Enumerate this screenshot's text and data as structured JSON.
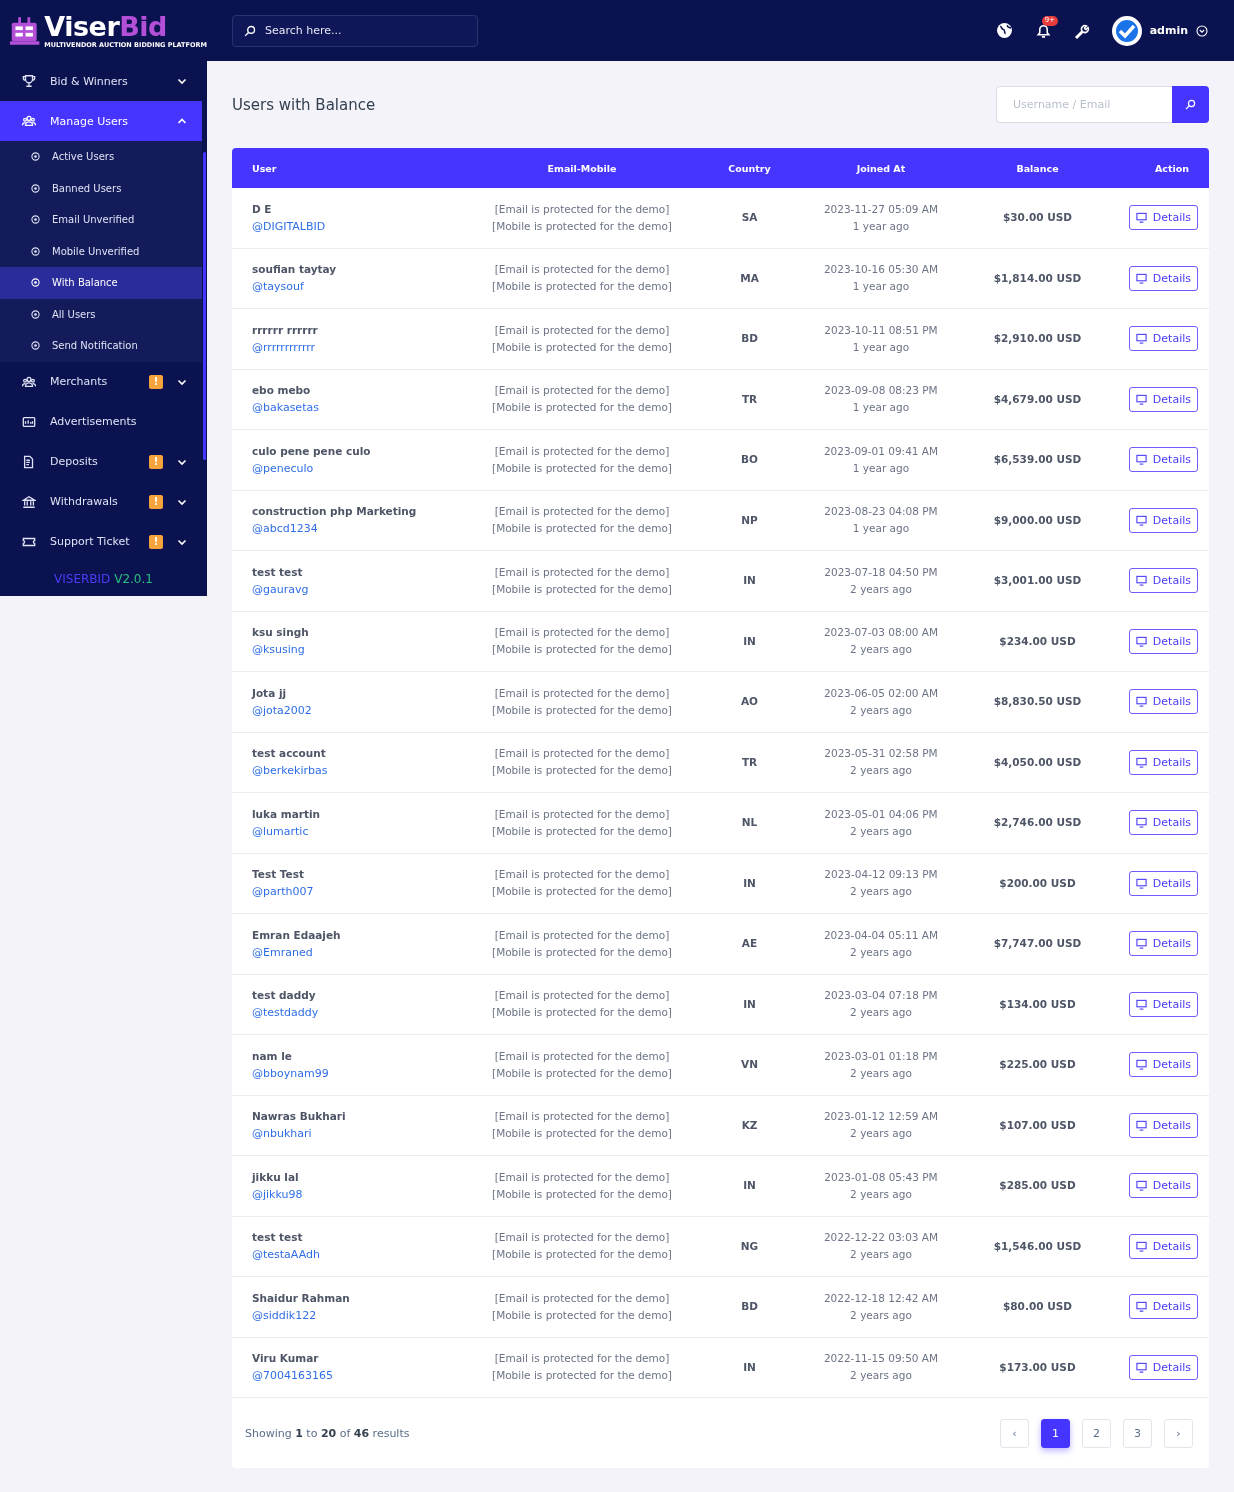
{
  "sidebar": {
    "logo": {
      "word_1": "Viser",
      "word_2": "Bid",
      "tagline": "MULTIVENDOR AUCTION BIDDING PLATFORM"
    },
    "items": [
      {
        "label": "Bid & Winners",
        "selected": false,
        "expanded": false
      },
      {
        "label": "Manage Users",
        "selected": true,
        "expanded": true,
        "children": [
          {
            "label": "Active Users",
            "selected": false
          },
          {
            "label": "Banned Users",
            "selected": false
          },
          {
            "label": "Email Unverified",
            "selected": false
          },
          {
            "label": "Mobile Unverified",
            "selected": false
          },
          {
            "label": "With Balance",
            "selected": true
          },
          {
            "label": "All Users",
            "selected": false
          },
          {
            "label": "Send Notification",
            "selected": false
          }
        ]
      },
      {
        "label": "Merchants",
        "selected": false,
        "expanded": false,
        "badge": "!"
      },
      {
        "label": "Advertisements",
        "selected": false
      },
      {
        "label": "Deposits",
        "selected": false,
        "expanded": false,
        "badge": "!"
      },
      {
        "label": "Withdrawals",
        "selected": false,
        "expanded": false,
        "badge": "!"
      },
      {
        "label": "Support Ticket",
        "selected": false,
        "expanded": false,
        "badge": "!"
      }
    ],
    "version": {
      "name": "VISERBID",
      "number": "V2.0.1"
    }
  },
  "topbar": {
    "search": {
      "placeholder": "Search here..."
    },
    "notification_count": "9+",
    "user": "admin"
  },
  "page": {
    "title": "Users with Balance",
    "search": {
      "placeholder": "Username / Email"
    }
  },
  "table": {
    "columns": [
      "User",
      "Email-Mobile",
      "Country",
      "Joined At",
      "Balance",
      "Action"
    ],
    "rows": [
      {
        "name": "D E",
        "username": "@DIGITALBID",
        "email": "[Email is protected for the demo]",
        "mobile": "[Mobile is protected for the demo]",
        "country": "SA",
        "joined": "2023-11-27 05:09 AM",
        "ago": "1 year ago",
        "balance": "$30.00 USD",
        "action": "Details"
      },
      {
        "name": "soufian taytay",
        "username": "@taysouf",
        "email": "[Email is protected for the demo]",
        "mobile": "[Mobile is protected for the demo]",
        "country": "MA",
        "joined": "2023-10-16 05:30 AM",
        "ago": "1 year ago",
        "balance": "$1,814.00 USD",
        "action": "Details"
      },
      {
        "name": "rrrrrr rrrrrr",
        "username": "@rrrrrrrrrrrr",
        "email": "[Email is protected for the demo]",
        "mobile": "[Mobile is protected for the demo]",
        "country": "BD",
        "joined": "2023-10-11 08:51 PM",
        "ago": "1 year ago",
        "balance": "$2,910.00 USD",
        "action": "Details"
      },
      {
        "name": "ebo mebo",
        "username": "@bakasetas",
        "email": "[Email is protected for the demo]",
        "mobile": "[Mobile is protected for the demo]",
        "country": "TR",
        "joined": "2023-09-08 08:23 PM",
        "ago": "1 year ago",
        "balance": "$4,679.00 USD",
        "action": "Details"
      },
      {
        "name": "culo pene pene culo",
        "username": "@peneculo",
        "email": "[Email is protected for the demo]",
        "mobile": "[Mobile is protected for the demo]",
        "country": "BO",
        "joined": "2023-09-01 09:41 AM",
        "ago": "1 year ago",
        "balance": "$6,539.00 USD",
        "action": "Details"
      },
      {
        "name": "construction php Marketing",
        "username": "@abcd1234",
        "email": "[Email is protected for the demo]",
        "mobile": "[Mobile is protected for the demo]",
        "country": "NP",
        "joined": "2023-08-23 04:08 PM",
        "ago": "1 year ago",
        "balance": "$9,000.00 USD",
        "action": "Details"
      },
      {
        "name": "test test",
        "username": "@gauravg",
        "email": "[Email is protected for the demo]",
        "mobile": "[Mobile is protected for the demo]",
        "country": "IN",
        "joined": "2023-07-18 04:50 PM",
        "ago": "2 years ago",
        "balance": "$3,001.00 USD",
        "action": "Details"
      },
      {
        "name": "ksu singh",
        "username": "@ksusing",
        "email": "[Email is protected for the demo]",
        "mobile": "[Mobile is protected for the demo]",
        "country": "IN",
        "joined": "2023-07-03 08:00 AM",
        "ago": "2 years ago",
        "balance": "$234.00 USD",
        "action": "Details"
      },
      {
        "name": "Jota jj",
        "username": "@jota2002",
        "email": "[Email is protected for the demo]",
        "mobile": "[Mobile is protected for the demo]",
        "country": "AO",
        "joined": "2023-06-05 02:00 AM",
        "ago": "2 years ago",
        "balance": "$8,830.50 USD",
        "action": "Details"
      },
      {
        "name": "test account",
        "username": "@berkekirbas",
        "email": "[Email is protected for the demo]",
        "mobile": "[Mobile is protected for the demo]",
        "country": "TR",
        "joined": "2023-05-31 02:58 PM",
        "ago": "2 years ago",
        "balance": "$4,050.00 USD",
        "action": "Details"
      },
      {
        "name": "luka martin",
        "username": "@lumartic",
        "email": "[Email is protected for the demo]",
        "mobile": "[Mobile is protected for the demo]",
        "country": "NL",
        "joined": "2023-05-01 04:06 PM",
        "ago": "2 years ago",
        "balance": "$2,746.00 USD",
        "action": "Details"
      },
      {
        "name": "Test Test",
        "username": "@parth007",
        "email": "[Email is protected for the demo]",
        "mobile": "[Mobile is protected for the demo]",
        "country": "IN",
        "joined": "2023-04-12 09:13 PM",
        "ago": "2 years ago",
        "balance": "$200.00 USD",
        "action": "Details"
      },
      {
        "name": "Emran Edaajeh",
        "username": "@Emraned",
        "email": "[Email is protected for the demo]",
        "mobile": "[Mobile is protected for the demo]",
        "country": "AE",
        "joined": "2023-04-04 05:11 AM",
        "ago": "2 years ago",
        "balance": "$7,747.00 USD",
        "action": "Details"
      },
      {
        "name": "test daddy",
        "username": "@testdaddy",
        "email": "[Email is protected for the demo]",
        "mobile": "[Mobile is protected for the demo]",
        "country": "IN",
        "joined": "2023-03-04 07:18 PM",
        "ago": "2 years ago",
        "balance": "$134.00 USD",
        "action": "Details"
      },
      {
        "name": "nam le",
        "username": "@bboynam99",
        "email": "[Email is protected for the demo]",
        "mobile": "[Mobile is protected for the demo]",
        "country": "VN",
        "joined": "2023-03-01 01:18 PM",
        "ago": "2 years ago",
        "balance": "$225.00 USD",
        "action": "Details"
      },
      {
        "name": "Nawras Bukhari",
        "username": "@nbukhari",
        "email": "[Email is protected for the demo]",
        "mobile": "[Mobile is protected for the demo]",
        "country": "KZ",
        "joined": "2023-01-12 12:59 AM",
        "ago": "2 years ago",
        "balance": "$107.00 USD",
        "action": "Details"
      },
      {
        "name": "jikku lal",
        "username": "@jikku98",
        "email": "[Email is protected for the demo]",
        "mobile": "[Mobile is protected for the demo]",
        "country": "IN",
        "joined": "2023-01-08 05:43 PM",
        "ago": "2 years ago",
        "balance": "$285.00 USD",
        "action": "Details"
      },
      {
        "name": "test test",
        "username": "@testaAAdh",
        "email": "[Email is protected for the demo]",
        "mobile": "[Mobile is protected for the demo]",
        "country": "NG",
        "joined": "2022-12-22 03:03 AM",
        "ago": "2 years ago",
        "balance": "$1,546.00 USD",
        "action": "Details"
      },
      {
        "name": "Shaidur Rahman",
        "username": "@siddik122",
        "email": "[Email is protected for the demo]",
        "mobile": "[Mobile is protected for the demo]",
        "country": "BD",
        "joined": "2022-12-18 12:42 AM",
        "ago": "2 years ago",
        "balance": "$80.00 USD",
        "action": "Details"
      },
      {
        "name": "Viru Kumar",
        "username": "@7004163165",
        "email": "[Email is protected for the demo]",
        "mobile": "[Mobile is protected for the demo]",
        "country": "IN",
        "joined": "2022-11-15 09:50 AM",
        "ago": "2 years ago",
        "balance": "$173.00 USD",
        "action": "Details"
      }
    ]
  },
  "pagination": {
    "summary": "Showing **1** to **20** of **46** results",
    "prev": "‹",
    "next": "›",
    "pages": [
      {
        "label": "1",
        "selected": true
      },
      {
        "label": "2",
        "selected": false
      },
      {
        "label": "3",
        "selected": false
      }
    ]
  }
}
